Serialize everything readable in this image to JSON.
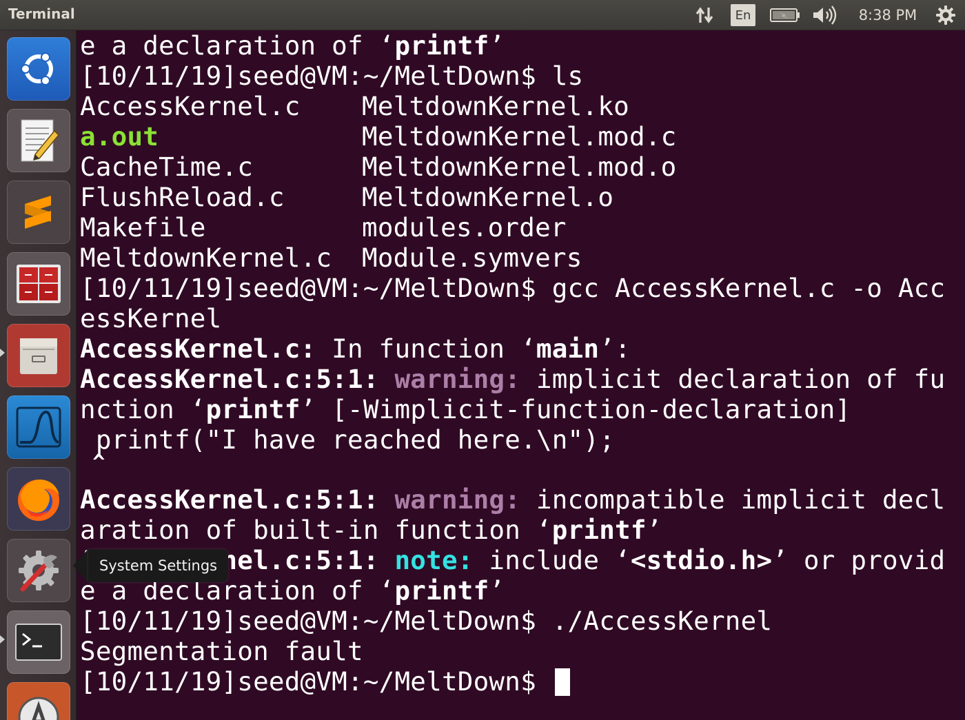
{
  "panel": {
    "app_title": "Terminal",
    "language": "En",
    "clock": "8:38 PM",
    "icons": [
      "network-icon",
      "keyboard-language-indicator",
      "battery-icon",
      "volume-icon",
      "settings-gear-icon"
    ]
  },
  "launcher": {
    "items": [
      "ubuntu-dash",
      "text-editor",
      "sublime-text",
      "calculator-app",
      "file-manager",
      "wireshark",
      "firefox",
      "system-settings",
      "terminal",
      "software-updater"
    ],
    "tooltip": "System Settings"
  },
  "terminal": {
    "l1": {
      "a": "e a declaration of ‘",
      "b": "printf",
      "c": "’"
    },
    "l2": {
      "prompt": "[10/11/19]seed@VM:~/MeltDown$ ",
      "cmd": "ls"
    },
    "ls": [
      {
        "left": "AccessKernel.c",
        "right": "MeltdownKernel.ko"
      },
      {
        "left": "a.out",
        "right": "MeltdownKernel.mod.c"
      },
      {
        "left": "CacheTime.c",
        "right": "MeltdownKernel.mod.o"
      },
      {
        "left": "FlushReload.c",
        "right": "MeltdownKernel.o"
      },
      {
        "left": "Makefile",
        "right": "modules.order"
      },
      {
        "left": "MeltdownKernel.c",
        "right": "Module.symvers"
      }
    ],
    "l9": {
      "prompt": "[10/11/19]seed@VM:~/MeltDown$ ",
      "cmd": "gcc AccessKernel.c -o Acc"
    },
    "l10": "essKernel",
    "l11": {
      "file": "AccessKernel.c:",
      "a": " In function ‘",
      "b": "main",
      "c": "’:"
    },
    "l12": {
      "file": "AccessKernel.c:5:1:",
      "tag": " warning:",
      "text": " implicit declaration of fu"
    },
    "l13": {
      "a": "nction ‘",
      "b": "printf",
      "c": "’ [-Wimplicit-function-declaration]"
    },
    "l14": " printf(\"I have reached here.\\n\");",
    "l15": " ^",
    "l16": {
      "file": "AccessKernel.c:5:1:",
      "tag": " warning:",
      "text": " incompatible implicit decl"
    },
    "l17": {
      "a": "aration of built-in function ‘",
      "b": "printf",
      "c": "’"
    },
    "l18": {
      "file": "AccessKernel.c:5:1:",
      "tag": " note:",
      "a": " include ‘",
      "b": "<stdio.h>",
      "c": "’ or provid"
    },
    "l19": {
      "a": "e a declaration of ‘",
      "b": "printf",
      "c": "’"
    },
    "l20": {
      "prompt": "[10/11/19]seed@VM:~/MeltDown$ ",
      "cmd": "./AccessKernel"
    },
    "l21": "Segmentation fault",
    "l22": {
      "prompt": "[10/11/19]seed@VM:~/MeltDown$ "
    }
  },
  "colors": {
    "terminal_bg": "#300a24",
    "executable_green": "#8ae234",
    "warning_magenta": "#ad7fa8",
    "note_cyan": "#34e2e2"
  }
}
